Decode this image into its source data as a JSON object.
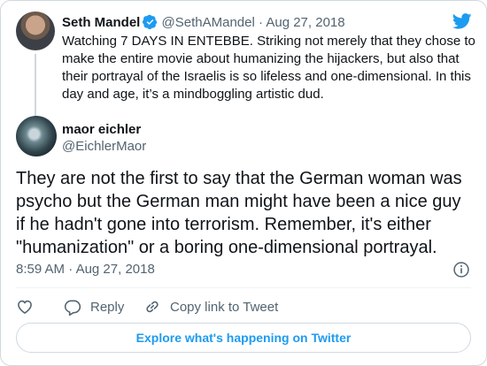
{
  "parent_tweet": {
    "author_name": "Seth Mandel",
    "handle": "@SethAMandel",
    "separator": "·",
    "date": "Aug 27, 2018",
    "text": "Watching 7 DAYS IN ENTEBBE. Striking not merely that they chose to make the entire movie about humanizing the hijackers, but also that their portrayal of the Israelis is so lifeless and one-dimensional. In this day and age, it’s a mindboggling artistic dud.",
    "verified": true
  },
  "tweet": {
    "author_name": "maor eichler",
    "handle": "@EichlerMaor",
    "text": "They are not the first to say that the German woman was psycho but the German man might have been a nice guy if he hadn't gone into terrorism. Remember, it's either \"humanization\" or a boring one-dimensional portrayal.",
    "time": "8:59 AM",
    "separator": "·",
    "date": "Aug 27, 2018"
  },
  "actions": {
    "like_icon": "heart-icon",
    "reply_label": "Reply",
    "copy_link_label": "Copy link to Tweet"
  },
  "explore_button": "Explore what's happening on Twitter",
  "colors": {
    "accent": "#1d9bf0",
    "muted_text": "#536471",
    "border": "#cfd9de"
  }
}
